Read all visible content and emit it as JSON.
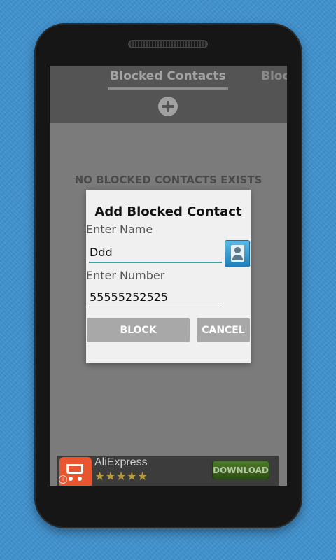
{
  "app": {
    "tabs": [
      {
        "label": "Blocked Contacts",
        "active": true
      },
      {
        "label": "Bloc",
        "active": false
      }
    ],
    "add_icon": "plus-circle-icon",
    "empty_message": "NO BLOCKED CONTACTS EXISTS"
  },
  "dialog": {
    "title": "Add Blocked Contact",
    "name_label": "Enter Name",
    "name_value": "Ddd",
    "number_label": "Enter Number",
    "number_value": "55555252525",
    "contact_picker_icon": "contact-card-icon",
    "block_label": "BLOCK",
    "cancel_label": "CANCEL"
  },
  "ad": {
    "title": "AliExpress",
    "stars_text": "★★★★★",
    "rating": 4.5,
    "download_label": "DOWNLOAD",
    "info_glyph": "i",
    "logo_icon": "shopping-cart-icon"
  },
  "colors": {
    "background": "#3f91cf",
    "dialog_accent": "#3e9fa2",
    "button_gray": "#a8a8a8"
  }
}
